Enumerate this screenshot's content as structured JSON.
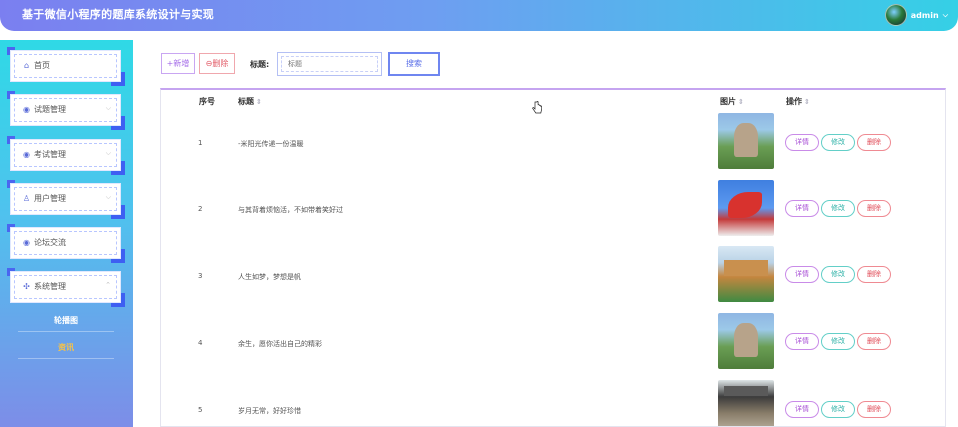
{
  "header": {
    "title": "基于微信小程序的题库系统设计与实现",
    "user_name": "admin",
    "caret": "⌵"
  },
  "sidebar": {
    "items": [
      {
        "label": "首页",
        "icon": "home-icon",
        "glyph": "⌂",
        "has_chevron": false,
        "chevron": ""
      },
      {
        "label": "试题管理",
        "icon": "grid-icon",
        "glyph": "◉",
        "has_chevron": true,
        "chevron": "⌵"
      },
      {
        "label": "考试管理",
        "icon": "grid-icon",
        "glyph": "◉",
        "has_chevron": true,
        "chevron": "⌵"
      },
      {
        "label": "用户管理",
        "icon": "user-icon",
        "glyph": "♙",
        "has_chevron": true,
        "chevron": "⌵"
      },
      {
        "label": "论坛交流",
        "icon": "grid-icon",
        "glyph": "◉",
        "has_chevron": false,
        "chevron": ""
      },
      {
        "label": "系统管理",
        "icon": "apps-icon",
        "glyph": "✣",
        "has_chevron": true,
        "chevron": "⌃"
      }
    ],
    "sub_items": [
      {
        "label": "轮播图",
        "color": "#ffffff"
      },
      {
        "label": "资讯",
        "color": "#f5c24a"
      }
    ]
  },
  "toolbar": {
    "add_label": "+新增",
    "delete_label": "⊖删除",
    "title_label": "标题:",
    "search_placeholder": "标题",
    "search_label": "搜索"
  },
  "table": {
    "headers": {
      "index": "序号",
      "title": "标题",
      "image": "图片",
      "actions": "操作",
      "sort": "⇕"
    },
    "rows": [
      {
        "index": "1",
        "title": "-米阳光传递一份温暖"
      },
      {
        "index": "2",
        "title": "与其背着烦恼活，不如带着笑好过"
      },
      {
        "index": "3",
        "title": "人生如梦，梦想是帆"
      },
      {
        "index": "4",
        "title": "余生，愿你活出自己的精彩"
      },
      {
        "index": "5",
        "title": "岁月无常，好好珍惜"
      }
    ],
    "actions": {
      "detail": "详情",
      "edit": "修改",
      "delete": "删除"
    }
  },
  "colors": {
    "accent": "#6f86f0",
    "header_start": "#7b7ff0",
    "header_end": "#35d0e6"
  }
}
